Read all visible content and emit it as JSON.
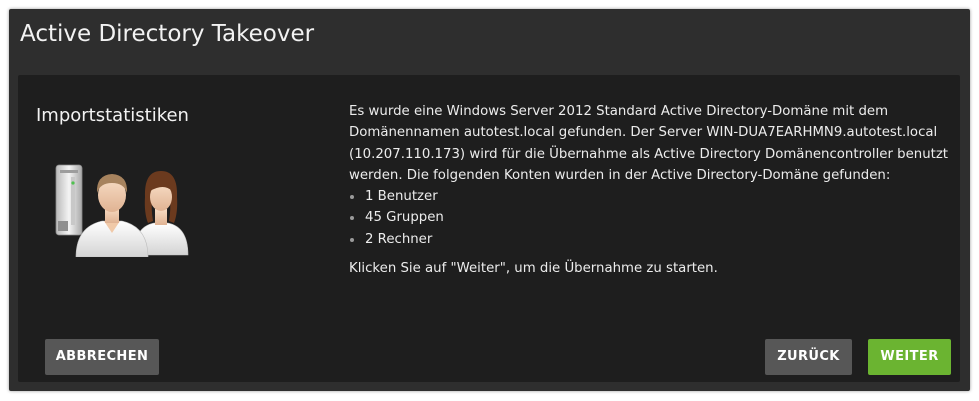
{
  "window": {
    "title": "Active Directory Takeover"
  },
  "section": {
    "title": "Importstatistiken"
  },
  "message": {
    "intro": "Es wurde eine Windows Server 2012 Standard Active Directory-Domäne mit dem Domänennamen autotest.local gefunden. Der Server WIN-DUA7EARHMN9.autotest.local (10.207.110.173) wird für die Übernahme als Active Directory Domänencontroller benutzt werden. Die folgenden Konten wurden in der Active Directory-Domäne gefunden:",
    "accounts": [
      "1 Benutzer",
      "45 Gruppen",
      "2 Rechner"
    ],
    "instruction": "Klicken Sie auf \"Weiter\", um die Übernahme zu starten."
  },
  "buttons": {
    "cancel": "ABBRECHEN",
    "back": "ZURÜCK",
    "next": "WEITER"
  },
  "illustration": {
    "icons": [
      "server-icon",
      "male-user-icon",
      "female-user-icon"
    ]
  },
  "colors": {
    "window_bg": "#2e2e2e",
    "content_bg": "#1e1e1e",
    "button_grey": "#575757",
    "button_green": "#6bb431",
    "text": "#f2f2f2"
  }
}
